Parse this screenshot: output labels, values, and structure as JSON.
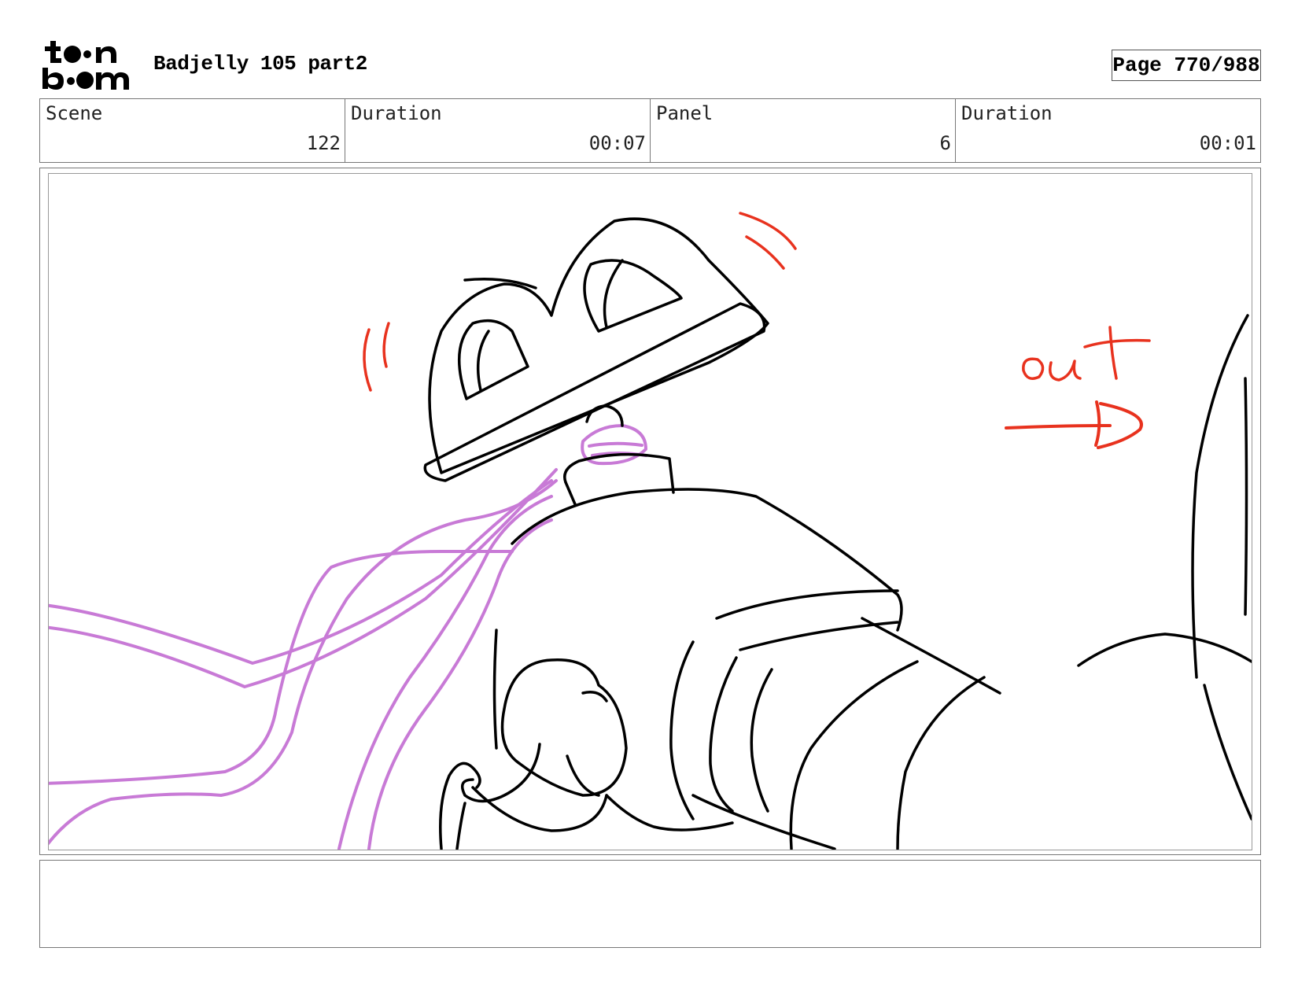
{
  "header": {
    "logo_top": "toon",
    "logo_bottom": "boom",
    "project_title": "Badjelly 105 part2",
    "page_label": "Page 770/988"
  },
  "info": {
    "scene_label": "Scene",
    "scene_value": "122",
    "scene_duration_label": "Duration",
    "scene_duration_value": "00:07",
    "panel_label": "Panel",
    "panel_value": "6",
    "panel_duration_label": "Duration",
    "panel_duration_value": "00:01"
  },
  "panel": {
    "annotation_text": "out",
    "colors": {
      "line_art": "#000000",
      "annotation": "#e8321e",
      "rope": "#c87ad6"
    }
  },
  "notes": {
    "text": ""
  }
}
